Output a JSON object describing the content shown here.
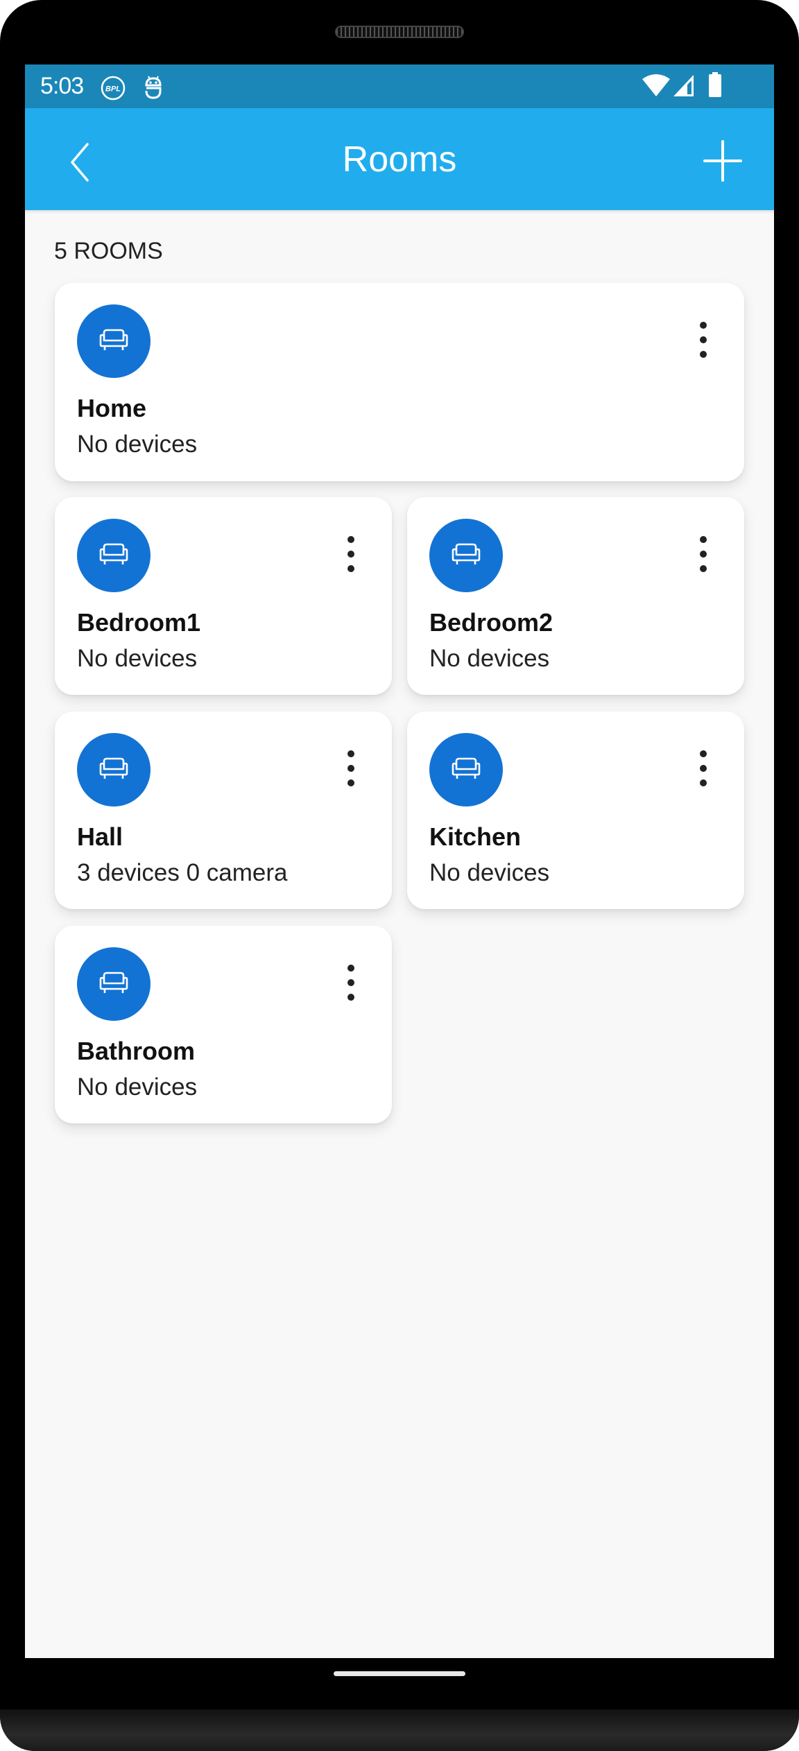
{
  "status_bar": {
    "time": "5:03",
    "left_icons": [
      "bpl-icon",
      "android-debug-icon"
    ],
    "right_icons": [
      "wifi-icon",
      "cellular-signal-icon",
      "battery-icon"
    ],
    "bpl_text": "BPL"
  },
  "app_bar": {
    "title": "Rooms",
    "back_icon": "chevron-left-icon",
    "add_icon": "plus-icon"
  },
  "rooms_count_label": "5 ROOMS",
  "colors": {
    "status_bar": "#1b87b8",
    "app_bar": "#21aded",
    "room_icon_bg": "#1373d4",
    "background": "#f8f8f8"
  },
  "rooms": [
    {
      "name": "Home",
      "status": "No devices",
      "icon": "sofa-icon"
    },
    {
      "name": "Bedroom1",
      "status": "No devices",
      "icon": "sofa-icon"
    },
    {
      "name": "Bedroom2",
      "status": "No devices",
      "icon": "sofa-icon"
    },
    {
      "name": "Hall",
      "status": "3 devices 0 camera",
      "icon": "sofa-icon"
    },
    {
      "name": "Kitchen",
      "status": "No devices",
      "icon": "sofa-icon"
    },
    {
      "name": "Bathroom",
      "status": "No devices",
      "icon": "sofa-icon"
    }
  ]
}
